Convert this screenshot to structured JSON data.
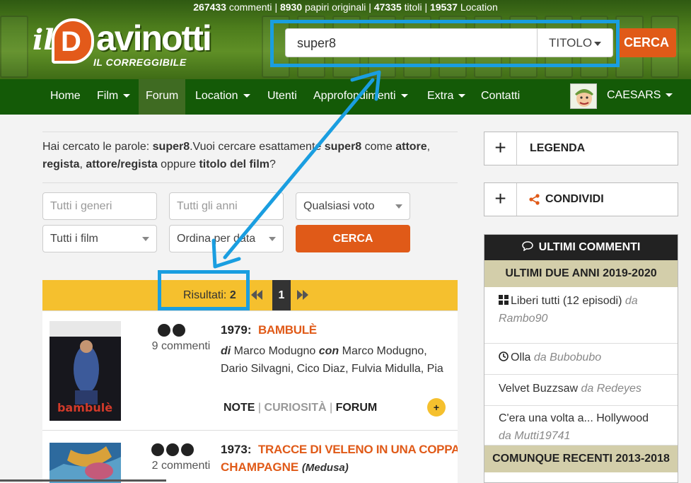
{
  "stats": {
    "comments": "267433",
    "comments_label": "commenti",
    "papiri": "8930",
    "papiri_label": "papiri originali",
    "titles": "47335",
    "titles_label": "titoli",
    "locations": "19537",
    "locations_label": "Location",
    "sep": "|"
  },
  "logo": {
    "il": "il",
    "name": "avinotti",
    "d": "D",
    "sub": "IL CORREGGIBILE"
  },
  "search": {
    "value": "super8",
    "type": "TITOLO",
    "button": "CERCA"
  },
  "nav": {
    "items": [
      {
        "label": "Home",
        "dropdown": false
      },
      {
        "label": "Film",
        "dropdown": true
      },
      {
        "label": "Forum",
        "dropdown": false,
        "active": true
      },
      {
        "label": "Location",
        "dropdown": true
      },
      {
        "label": "Utenti",
        "dropdown": false
      },
      {
        "label": "Approfondimenti",
        "dropdown": true
      },
      {
        "label": "Extra",
        "dropdown": true
      },
      {
        "label": "Contatti",
        "dropdown": false
      }
    ],
    "user": "CAESARS"
  },
  "searchinfo": {
    "p1": "Hai cercato le parole: ",
    "word": "super8",
    "p2": ".Vuoi cercare esattamente ",
    "word2": "super8",
    "p3": " come ",
    "o1": "attore",
    "c1": ", ",
    "o2": "regista",
    "c2": ", ",
    "o3": "attore/regista",
    "c3": " oppure ",
    "o4": "titolo del film",
    "c4": "?"
  },
  "filters": {
    "genre_placeholder": "Tutti i generi",
    "year_placeholder": "Tutti gli anni",
    "vote": "Qualsiasi voto",
    "films": "Tutti i film",
    "order": "Ordina per data",
    "button": "CERCA"
  },
  "results": {
    "label": "Risultati:",
    "count": "2",
    "page": "1"
  },
  "films": [
    {
      "year": "1979:",
      "title": "BAMBULÈ",
      "rating": 2,
      "comments": "9 commenti",
      "di": "di",
      "director": "Marco Modugno",
      "con": "con",
      "cast_rest": "Marco Modugno, Dario Silvagni, Cico Diaz, Fulvia Midulla, Pia",
      "poster_label": "bambulè",
      "links": [
        "NOTE",
        "CURIOSITÀ",
        "FORUM"
      ],
      "plus": "+"
    },
    {
      "year": "1973:",
      "title": "TRACCE DI VELENO IN UNA COPPA DI",
      "title2": "CHAMPAGNE",
      "label": "(Medusa)",
      "rating": 3,
      "comments": "2 commenti"
    }
  ],
  "sidebar": {
    "legenda": "LEGENDA",
    "condividi": "CONDIVIDI",
    "ultimi": "ULTIMI COMMENTI",
    "recent_header": "ULTIMI DUE ANNI 2019-2020",
    "comments": [
      {
        "text": "Liberi tutti (12 episodi)",
        "da": "da",
        "user": "Rambo90",
        "icon": "grid"
      },
      {
        "text": "Olla",
        "da": "da",
        "user": "Bubobubo",
        "icon": "clock"
      },
      {
        "text": "Velvet Buzzsaw",
        "da": "da",
        "user": "Redeyes",
        "icon": ""
      },
      {
        "text": "C'era una volta a... Hollywood",
        "da": "da",
        "user": "Mutti19741",
        "icon": ""
      }
    ],
    "older_header": "COMUNQUE RECENTI 2013-2018"
  },
  "colors": {
    "accent": "#e05a18",
    "nav": "#145a07",
    "bar": "#f5c02e",
    "annotation": "#1a9ee0"
  }
}
